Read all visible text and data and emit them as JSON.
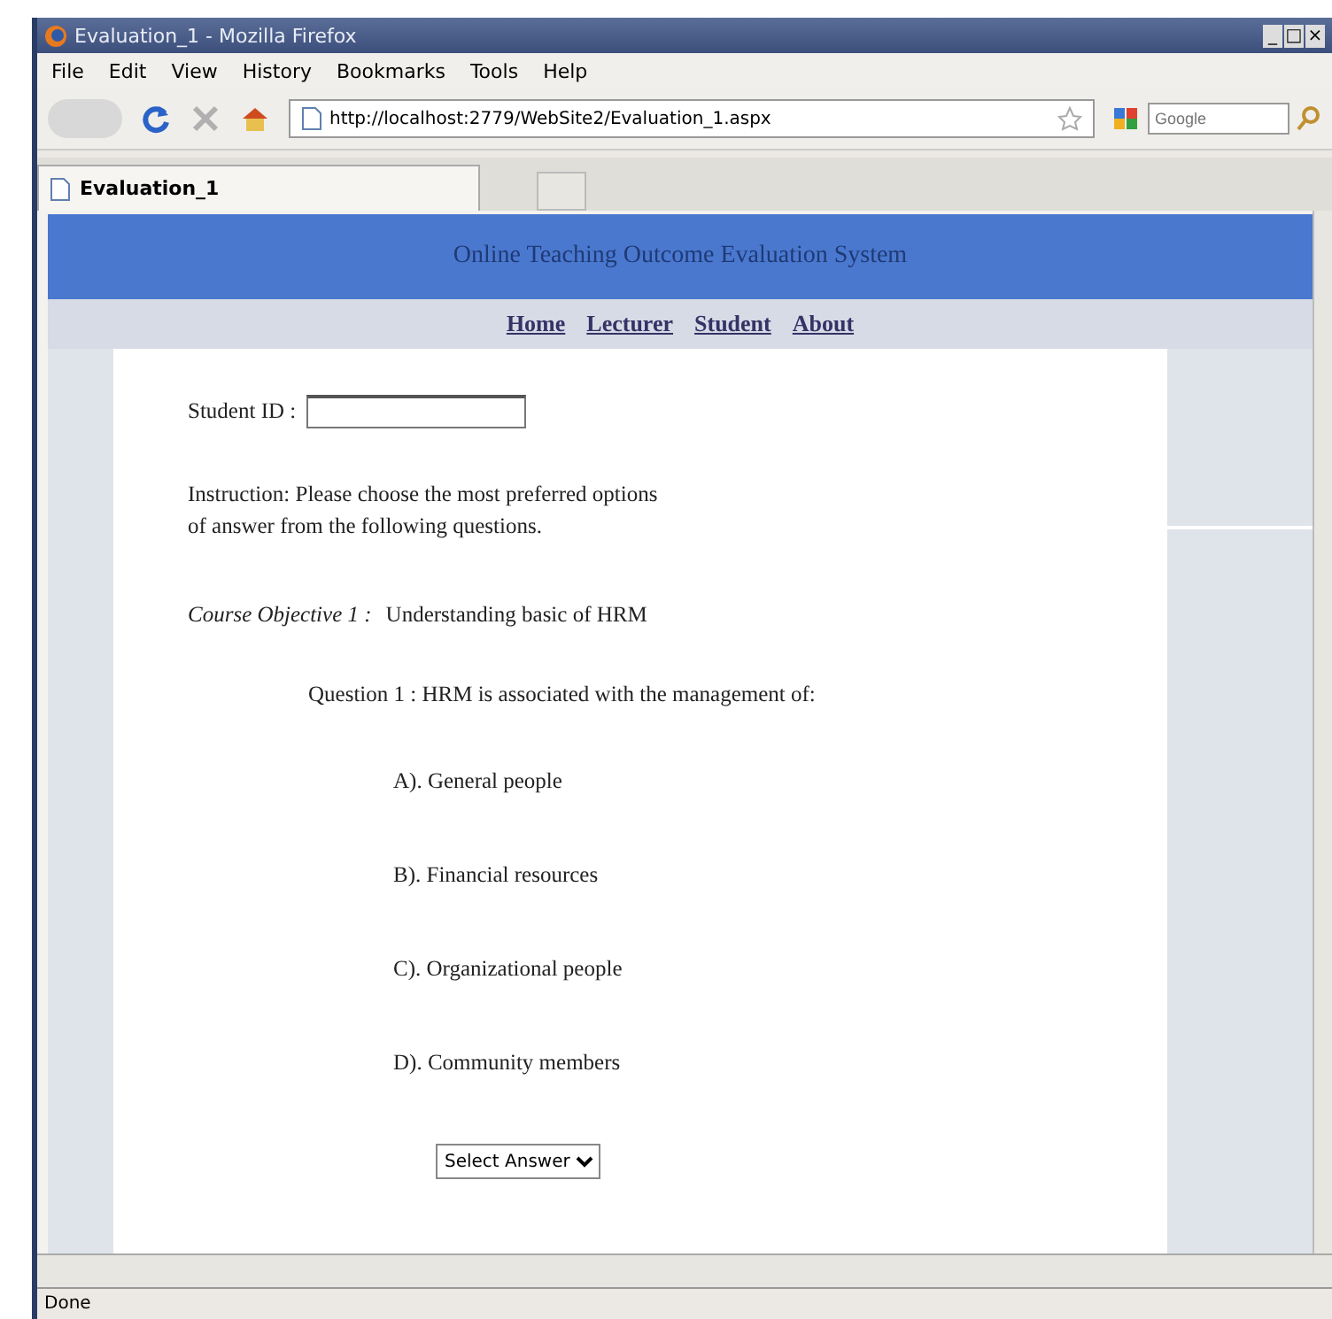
{
  "window": {
    "title": "Evaluation_1 - Mozilla Firefox",
    "controls": [
      "_",
      "□",
      "×"
    ]
  },
  "menu": [
    "File",
    "Edit",
    "View",
    "History",
    "Bookmarks",
    "Tools",
    "Help"
  ],
  "toolbar": {
    "url": "http://localhost:2779/WebSite2/Evaluation_1.aspx",
    "search_placeholder": "Google"
  },
  "tabs": [
    {
      "label": "Evaluation_1",
      "selected": true
    }
  ],
  "page": {
    "banner": "Online Teaching Outcome Evaluation System",
    "nav": [
      "Home",
      "Lecturer",
      "Student",
      "About"
    ],
    "student_id_label": "Student ID :",
    "instruction": [
      "Instruction: Please choose the most preferred options",
      "of answer from the following questions."
    ],
    "objective_label": "Course Objective 1 :",
    "objective": "Understanding basic of HRM",
    "question": "Question 1 : HRM is associated with the management of:",
    "options": [
      "A). General people",
      "B). Financial resources",
      "C). Organizational people",
      "D). Community members"
    ],
    "select": "Select Answer"
  },
  "status_bar": "Done"
}
